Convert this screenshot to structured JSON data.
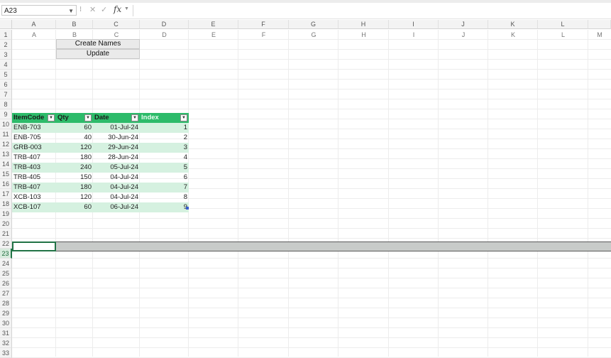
{
  "name_box": {
    "value": "A23"
  },
  "formula_bar": {
    "fx": "fx",
    "value": ""
  },
  "columns": [
    "A",
    "B",
    "C",
    "D",
    "E",
    "F",
    "G",
    "H",
    "I",
    "J",
    "K",
    "L",
    ""
  ],
  "rows": [
    "1",
    "2",
    "3",
    "4",
    "5",
    "6",
    "7",
    "8",
    "9",
    "10",
    "11",
    "12",
    "13",
    "14",
    "15",
    "16",
    "17",
    "18",
    "19",
    "20",
    "21",
    "22",
    "23",
    "24",
    "25",
    "26",
    "27",
    "28",
    "29",
    "30",
    "31",
    "32",
    "33"
  ],
  "row1_ghost": [
    "A",
    "B",
    "C",
    "D",
    "E",
    "F",
    "G",
    "H",
    "I",
    "J",
    "K",
    "L",
    "M"
  ],
  "buttons": {
    "create_names": "Create Names",
    "update": "Update"
  },
  "table": {
    "headers": [
      "ItemCode",
      "Qty",
      "Date",
      "Index"
    ],
    "rows": [
      {
        "code": "ENB-703",
        "qty": "60",
        "date": "01-Jul-24",
        "index": "1"
      },
      {
        "code": "ENB-705",
        "qty": "40",
        "date": "30-Jun-24",
        "index": "2"
      },
      {
        "code": "GRB-003",
        "qty": "120",
        "date": "29-Jun-24",
        "index": "3"
      },
      {
        "code": "TRB-407",
        "qty": "180",
        "date": "28-Jun-24",
        "index": "4"
      },
      {
        "code": "TRB-403",
        "qty": "240",
        "date": "05-Jul-24",
        "index": "5"
      },
      {
        "code": "TRB-405",
        "qty": "150",
        "date": "04-Jul-24",
        "index": "6"
      },
      {
        "code": "TRB-407",
        "qty": "180",
        "date": "04-Jul-24",
        "index": "7"
      },
      {
        "code": "XCB-103",
        "qty": "120",
        "date": "04-Jul-24",
        "index": "8"
      },
      {
        "code": "XCB-107",
        "qty": "60",
        "date": "06-Jul-24",
        "index": "9"
      }
    ]
  },
  "colors": {
    "header_green": "#2dbb6a",
    "band_green": "#d5f1e0",
    "accent": "#217346"
  },
  "icons": {
    "cancel": "close-icon",
    "enter": "check-icon",
    "filter": "filter-dropdown-icon"
  }
}
